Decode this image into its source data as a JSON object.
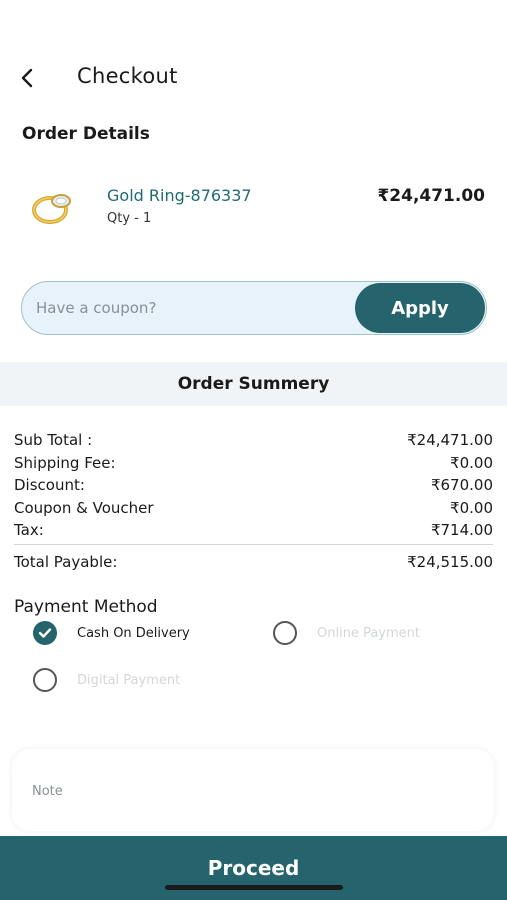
{
  "header": {
    "title": "Checkout",
    "back_icon": "chevron-left-icon"
  },
  "order_details": {
    "title": "Order Details",
    "item": {
      "name": "Gold Ring-876337",
      "qty": "Qty -  1",
      "price": "₹24,471.00",
      "image_icon": "gold-ring-image"
    }
  },
  "coupon": {
    "placeholder": "Have a coupon?",
    "value": "",
    "apply_label": "Apply"
  },
  "summary": {
    "title": "Order Summery",
    "rows": [
      {
        "label": "Sub Total :",
        "value": "₹24,471.00"
      },
      {
        "label": "Shipping Fee:",
        "value": "₹0.00"
      },
      {
        "label": "Discount:",
        "value": "₹670.00"
      },
      {
        "label": "Coupon & Voucher",
        "value": "₹0.00"
      },
      {
        "label": "Tax:",
        "value": "₹714.00"
      }
    ],
    "total": {
      "label": "Total Payable:",
      "value": "₹24,515.00"
    }
  },
  "payment": {
    "title": "Payment Method",
    "options": [
      {
        "label": "Cash On Delivery",
        "selected": true
      },
      {
        "label": "Online Payment",
        "selected": false
      },
      {
        "label": "Digital Payment",
        "selected": false
      }
    ]
  },
  "note": {
    "placeholder": "Note",
    "value": ""
  },
  "proceed_label": "Proceed",
  "colors": {
    "accent": "#25646c",
    "product_name": "#1f6b72",
    "coupon_bg": "#e7f2fb",
    "summary_band": "#f1f4f6"
  }
}
